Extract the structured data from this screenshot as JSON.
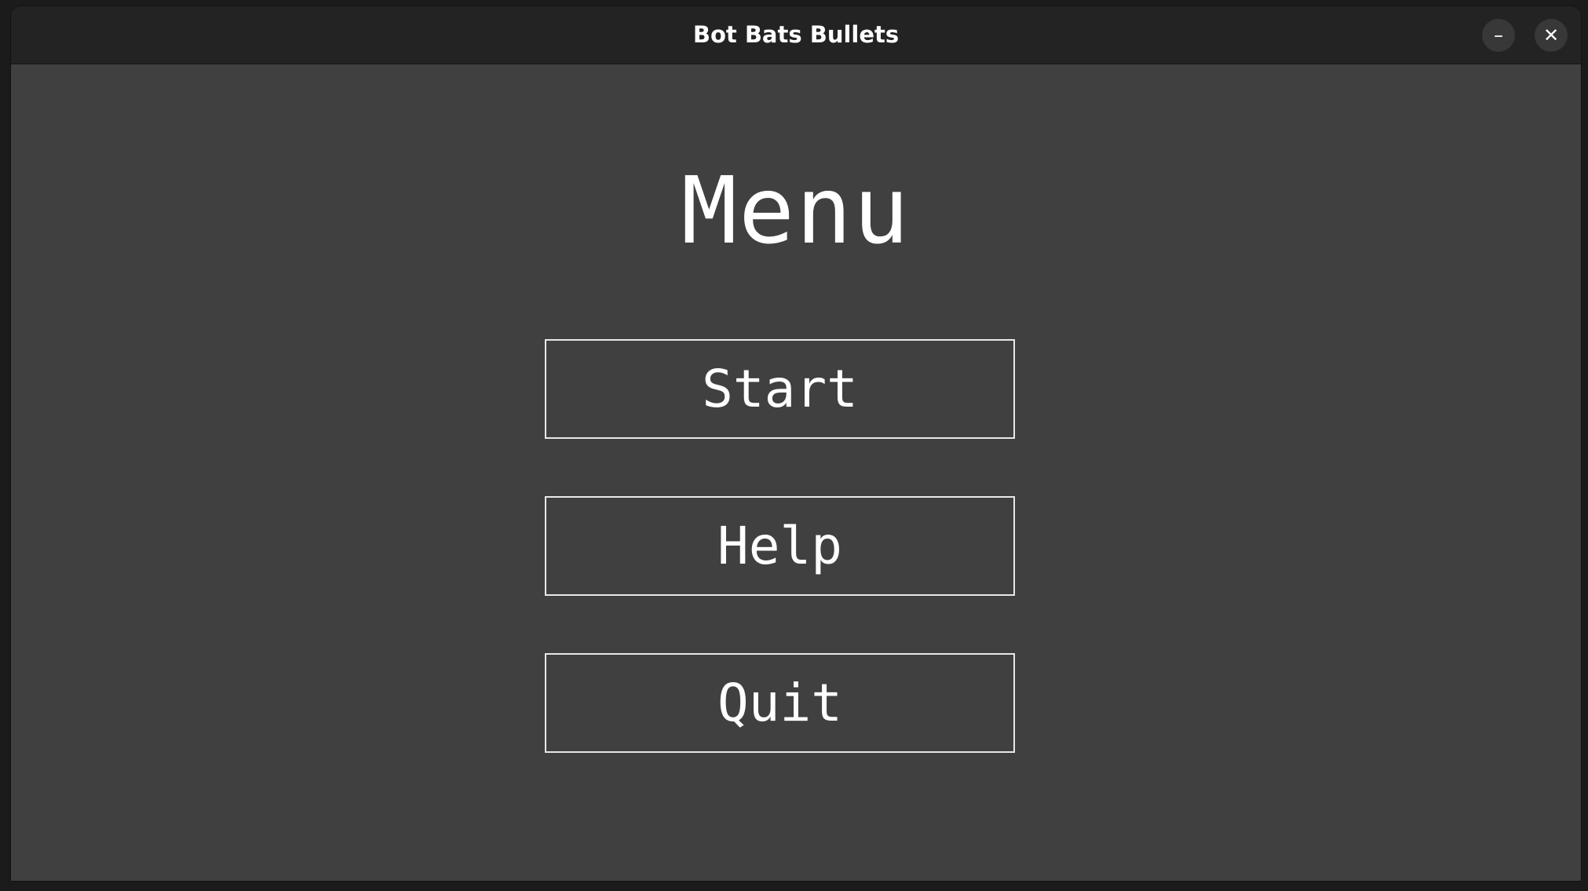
{
  "window": {
    "title": "Bot Bats Bullets",
    "minimize_icon": "minimize-icon",
    "close_icon": "close-icon"
  },
  "menu": {
    "heading": "Menu",
    "buttons": [
      {
        "label": "Start"
      },
      {
        "label": "Help"
      },
      {
        "label": "Quit"
      }
    ]
  }
}
